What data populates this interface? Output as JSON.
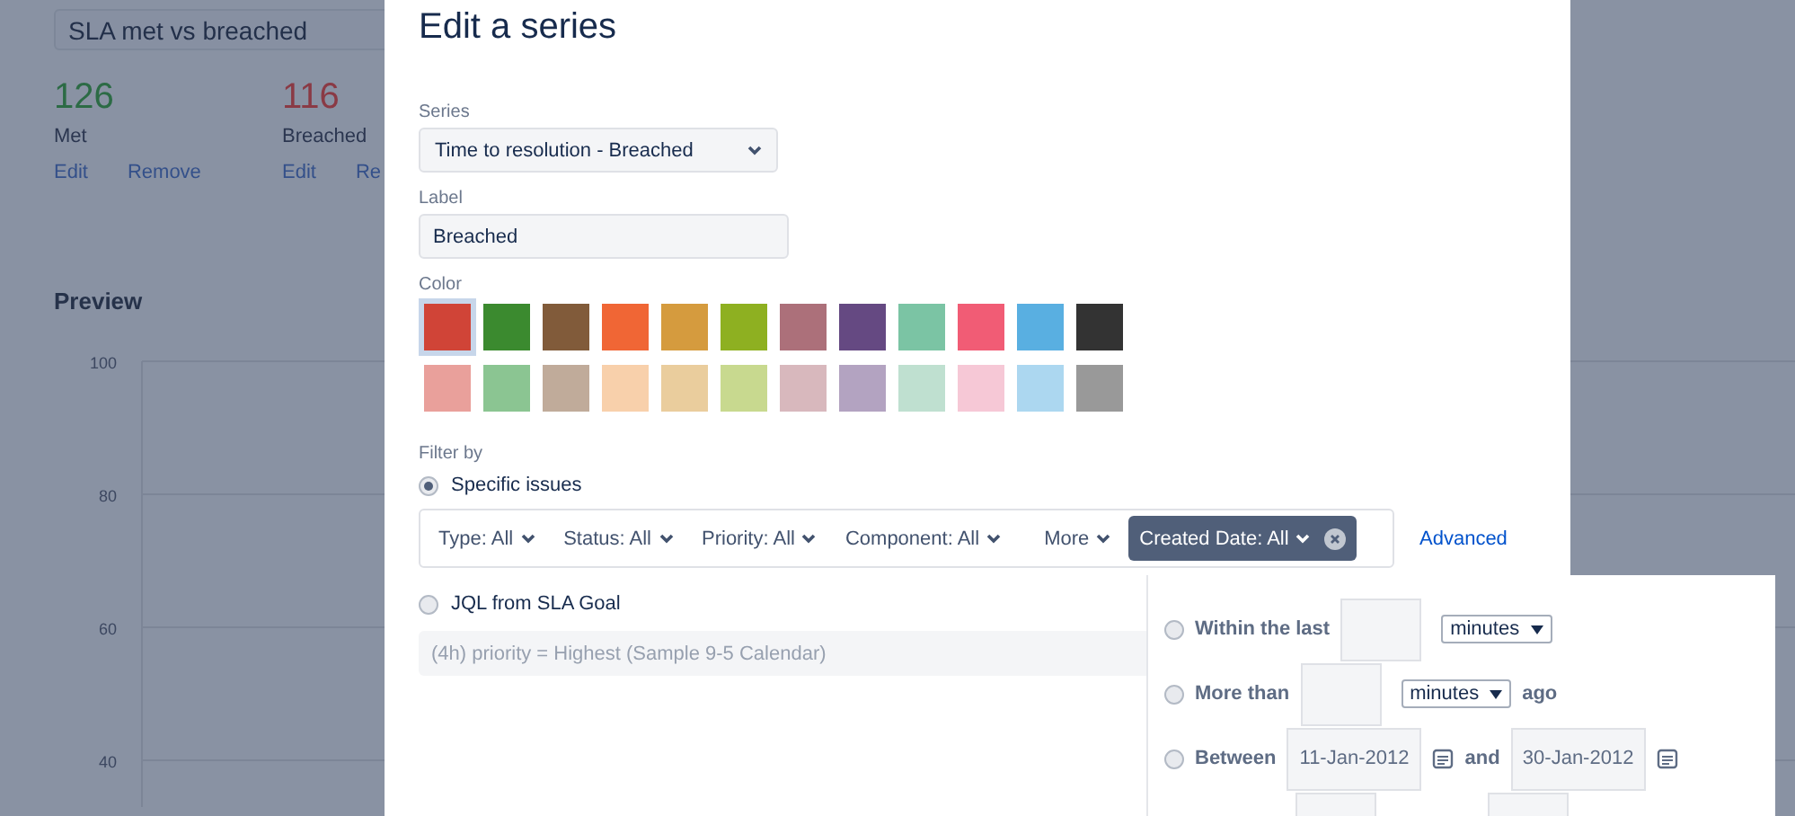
{
  "background": {
    "report_title": "SLA met vs breached",
    "stats": [
      {
        "value": "126",
        "label": "Met",
        "kind": "met",
        "actions": [
          "Edit",
          "Remove"
        ]
      },
      {
        "value": "116",
        "label": "Breached",
        "kind": "breached",
        "actions": [
          "Edit",
          "Re"
        ]
      }
    ],
    "preview": {
      "title": "Preview",
      "y_ticks": [
        "100",
        "80",
        "60",
        "40"
      ]
    }
  },
  "dialog": {
    "title": "Edit a series",
    "series": {
      "label": "Series",
      "value": "Time to resolution - Breached"
    },
    "label_field": {
      "label": "Label",
      "value": "Breached"
    },
    "color": {
      "label": "Color",
      "swatches": [
        {
          "color": "#d04437",
          "selected": true
        },
        {
          "color": "#3b8a2f",
          "selected": false
        },
        {
          "color": "#815b3a",
          "selected": false
        },
        {
          "color": "#f06635",
          "selected": false
        },
        {
          "color": "#d59b3e",
          "selected": false
        },
        {
          "color": "#8eb021",
          "selected": false
        },
        {
          "color": "#ac707a",
          "selected": false
        },
        {
          "color": "#654982",
          "selected": false
        },
        {
          "color": "#7bc4a4",
          "selected": false
        },
        {
          "color": "#f15c75",
          "selected": false
        },
        {
          "color": "#59afe1",
          "selected": false
        },
        {
          "color": "#333333",
          "selected": false
        },
        {
          "color": "#e9a09b",
          "selected": false
        },
        {
          "color": "#8bc592",
          "selected": false
        },
        {
          "color": "#c0ab9a",
          "selected": false
        },
        {
          "color": "#f8d0ab",
          "selected": false
        },
        {
          "color": "#eacd9d",
          "selected": false
        },
        {
          "color": "#c8d98f",
          "selected": false
        },
        {
          "color": "#d8b8bd",
          "selected": false
        },
        {
          "color": "#b3a3c1",
          "selected": false
        },
        {
          "color": "#bfe0d0",
          "selected": false
        },
        {
          "color": "#f6c8d6",
          "selected": false
        },
        {
          "color": "#acd7f0",
          "selected": false
        },
        {
          "color": "#999999",
          "selected": false
        }
      ]
    },
    "filter": {
      "label": "Filter by",
      "options": [
        {
          "label": "Specific issues",
          "selected": true
        },
        {
          "label": "JQL from SLA Goal",
          "selected": false
        }
      ],
      "chips": [
        {
          "label": "Type: All",
          "active": false
        },
        {
          "label": "Status: All",
          "active": false
        },
        {
          "label": "Priority: All",
          "active": false
        },
        {
          "label": "Component: All",
          "active": false
        },
        {
          "label": "More",
          "active": false
        },
        {
          "label": "Created Date: All",
          "active": true
        }
      ],
      "advanced": "Advanced",
      "jql_query": "(4h) priority = Highest (Sample 9-5 Calendar)"
    }
  },
  "date_popup": {
    "rows": [
      {
        "selected": false,
        "parts": [
          {
            "kind": "label",
            "text": "Within the last"
          },
          {
            "kind": "input"
          },
          {
            "kind": "select",
            "text": "minutes"
          }
        ]
      },
      {
        "selected": false,
        "parts": [
          {
            "kind": "label",
            "text": "More than"
          },
          {
            "kind": "input"
          },
          {
            "kind": "select",
            "text": "minutes"
          },
          {
            "kind": "label",
            "text": "ago"
          }
        ]
      },
      {
        "selected": false,
        "parts": [
          {
            "kind": "label",
            "text": "Between"
          },
          {
            "kind": "date",
            "text": "11-Jan-2012"
          },
          {
            "kind": "label",
            "text": "and"
          },
          {
            "kind": "date",
            "text": "30-Jan-2012"
          }
        ]
      },
      {
        "parts": [
          {
            "kind": "spacer"
          },
          {
            "kind": "input"
          },
          {
            "kind": "spacer"
          },
          {
            "kind": "input"
          }
        ]
      }
    ]
  }
}
